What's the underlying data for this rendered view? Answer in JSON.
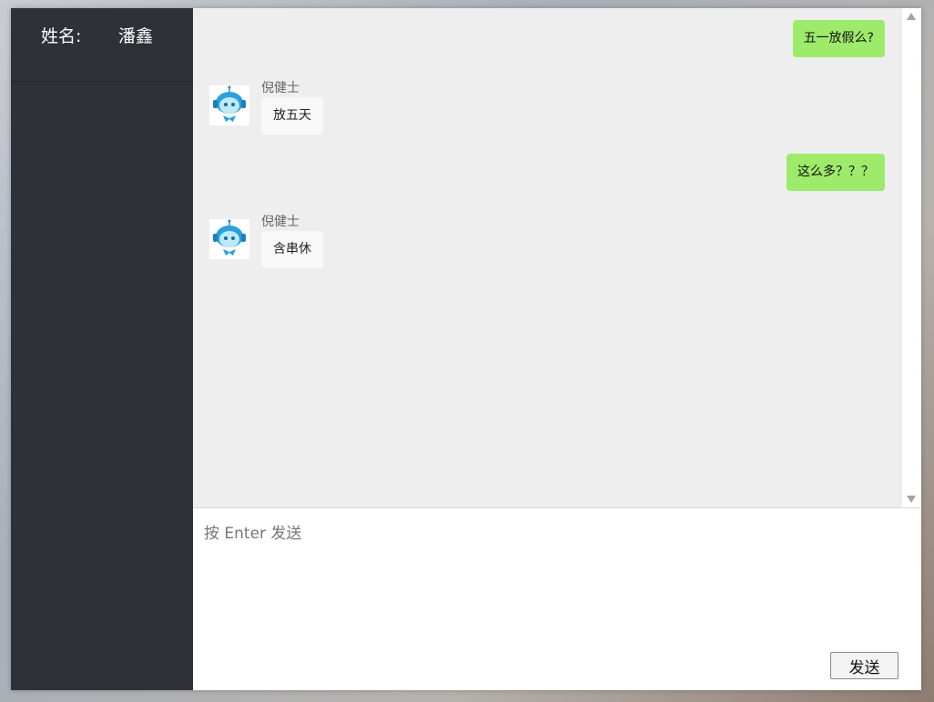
{
  "sidebar": {
    "name_label": "姓名:",
    "name_value": "潘鑫"
  },
  "messages": [
    {
      "type": "sent",
      "text": "五一放假么?"
    },
    {
      "type": "received",
      "sender": "倪健士",
      "text": "放五天",
      "avatar": "robot-avatar-icon"
    },
    {
      "type": "sent",
      "text": "这么多？？？"
    },
    {
      "type": "received",
      "sender": "倪健士",
      "text": "含串休",
      "avatar": "robot-avatar-icon"
    }
  ],
  "composer": {
    "placeholder": "按 Enter 发送",
    "value": "",
    "send_label": "发送"
  },
  "colors": {
    "sidebar_bg": "#2e3238",
    "chat_bg": "#eeeeee",
    "sent_bubble": "#9eea6a",
    "received_bubble": "#f8f8f8"
  }
}
